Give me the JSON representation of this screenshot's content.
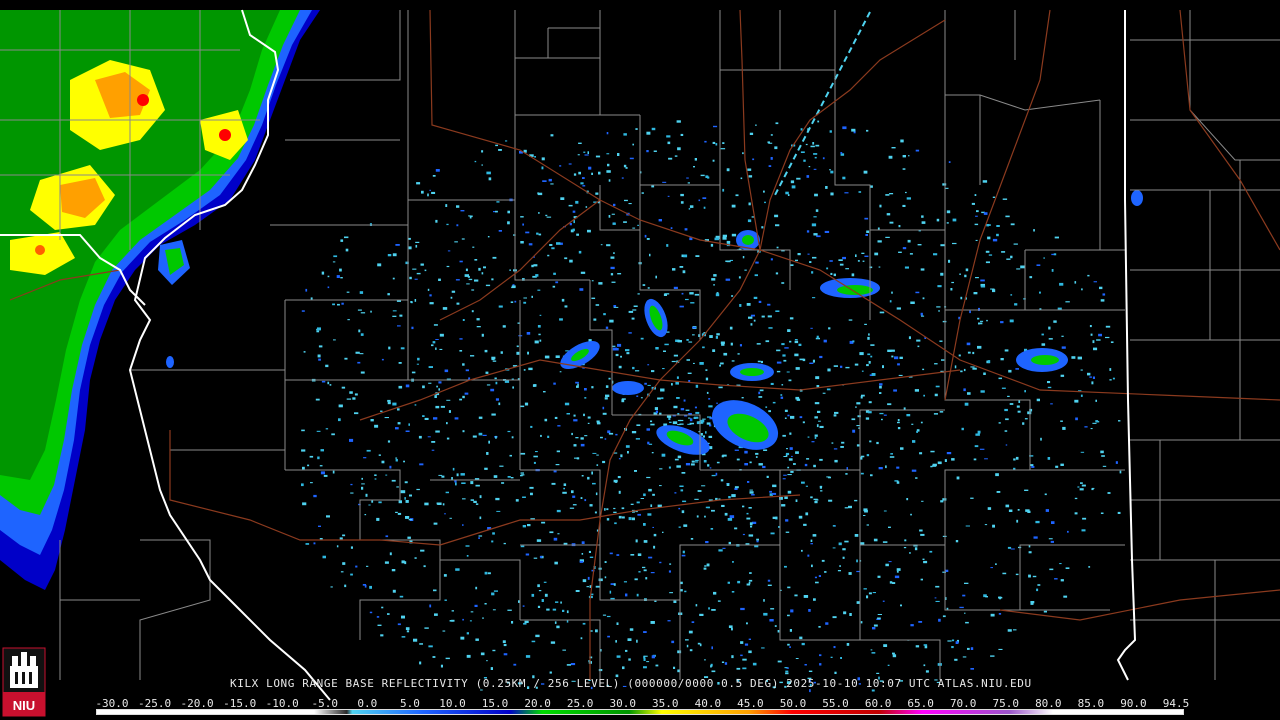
{
  "caption": {
    "text": "KILX LONG RANGE BASE REFLECTIVITY (0.25KM / 256 LEVEL) (000000/0000 0.5 DEG) 2025-10-10 10:07 UTC  ATLAS.NIU.EDU"
  },
  "scale": {
    "labels": [
      "-30.0",
      "-25.0",
      "-20.0",
      "-15.0",
      "-10.0",
      "-5.0",
      "0.0",
      "5.0",
      "10.0",
      "15.0",
      "20.0",
      "25.0",
      "30.0",
      "35.0",
      "40.0",
      "45.0",
      "50.0",
      "55.0",
      "60.0",
      "65.0",
      "70.0",
      "75.0",
      "80.0",
      "85.0",
      "90.0",
      "94.5"
    ],
    "colors": {
      "dark-gray": "#2a2a2a",
      "light-blue": "#4fd3f0",
      "blue": "#1e64ff",
      "dark-blue": "#0000c8",
      "green": "#00dc00",
      "dark-green": "#009600",
      "yellow": "#ffff00",
      "orange": "#ffa000",
      "red": "#ff0000",
      "dark-red": "#c00000",
      "magenta": "#ff00ff",
      "purple": "#9a55c9",
      "white": "#ffffff"
    }
  },
  "logo": {
    "text": "NIU",
    "accent": "#c8102e"
  },
  "map": {
    "state_border_color": "#ffffff",
    "county_color": "#8a8a8a",
    "highway_color": "#8b3a1e"
  }
}
